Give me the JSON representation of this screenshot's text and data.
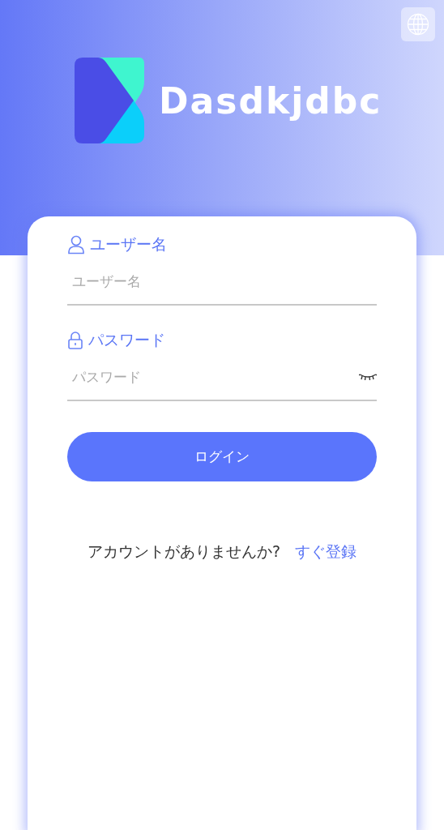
{
  "brand": {
    "name": "Dasdkjdbc"
  },
  "fields": [
    {
      "kind": "text",
      "label": "ユーザー名",
      "placeholder": "ユーザー名"
    },
    {
      "kind": "password",
      "label": "パスワード",
      "placeholder": "パスワード"
    }
  ],
  "login_button": "ログイン",
  "signup": {
    "prompt": "アカウントがありませんか?",
    "link": "すぐ登録"
  }
}
